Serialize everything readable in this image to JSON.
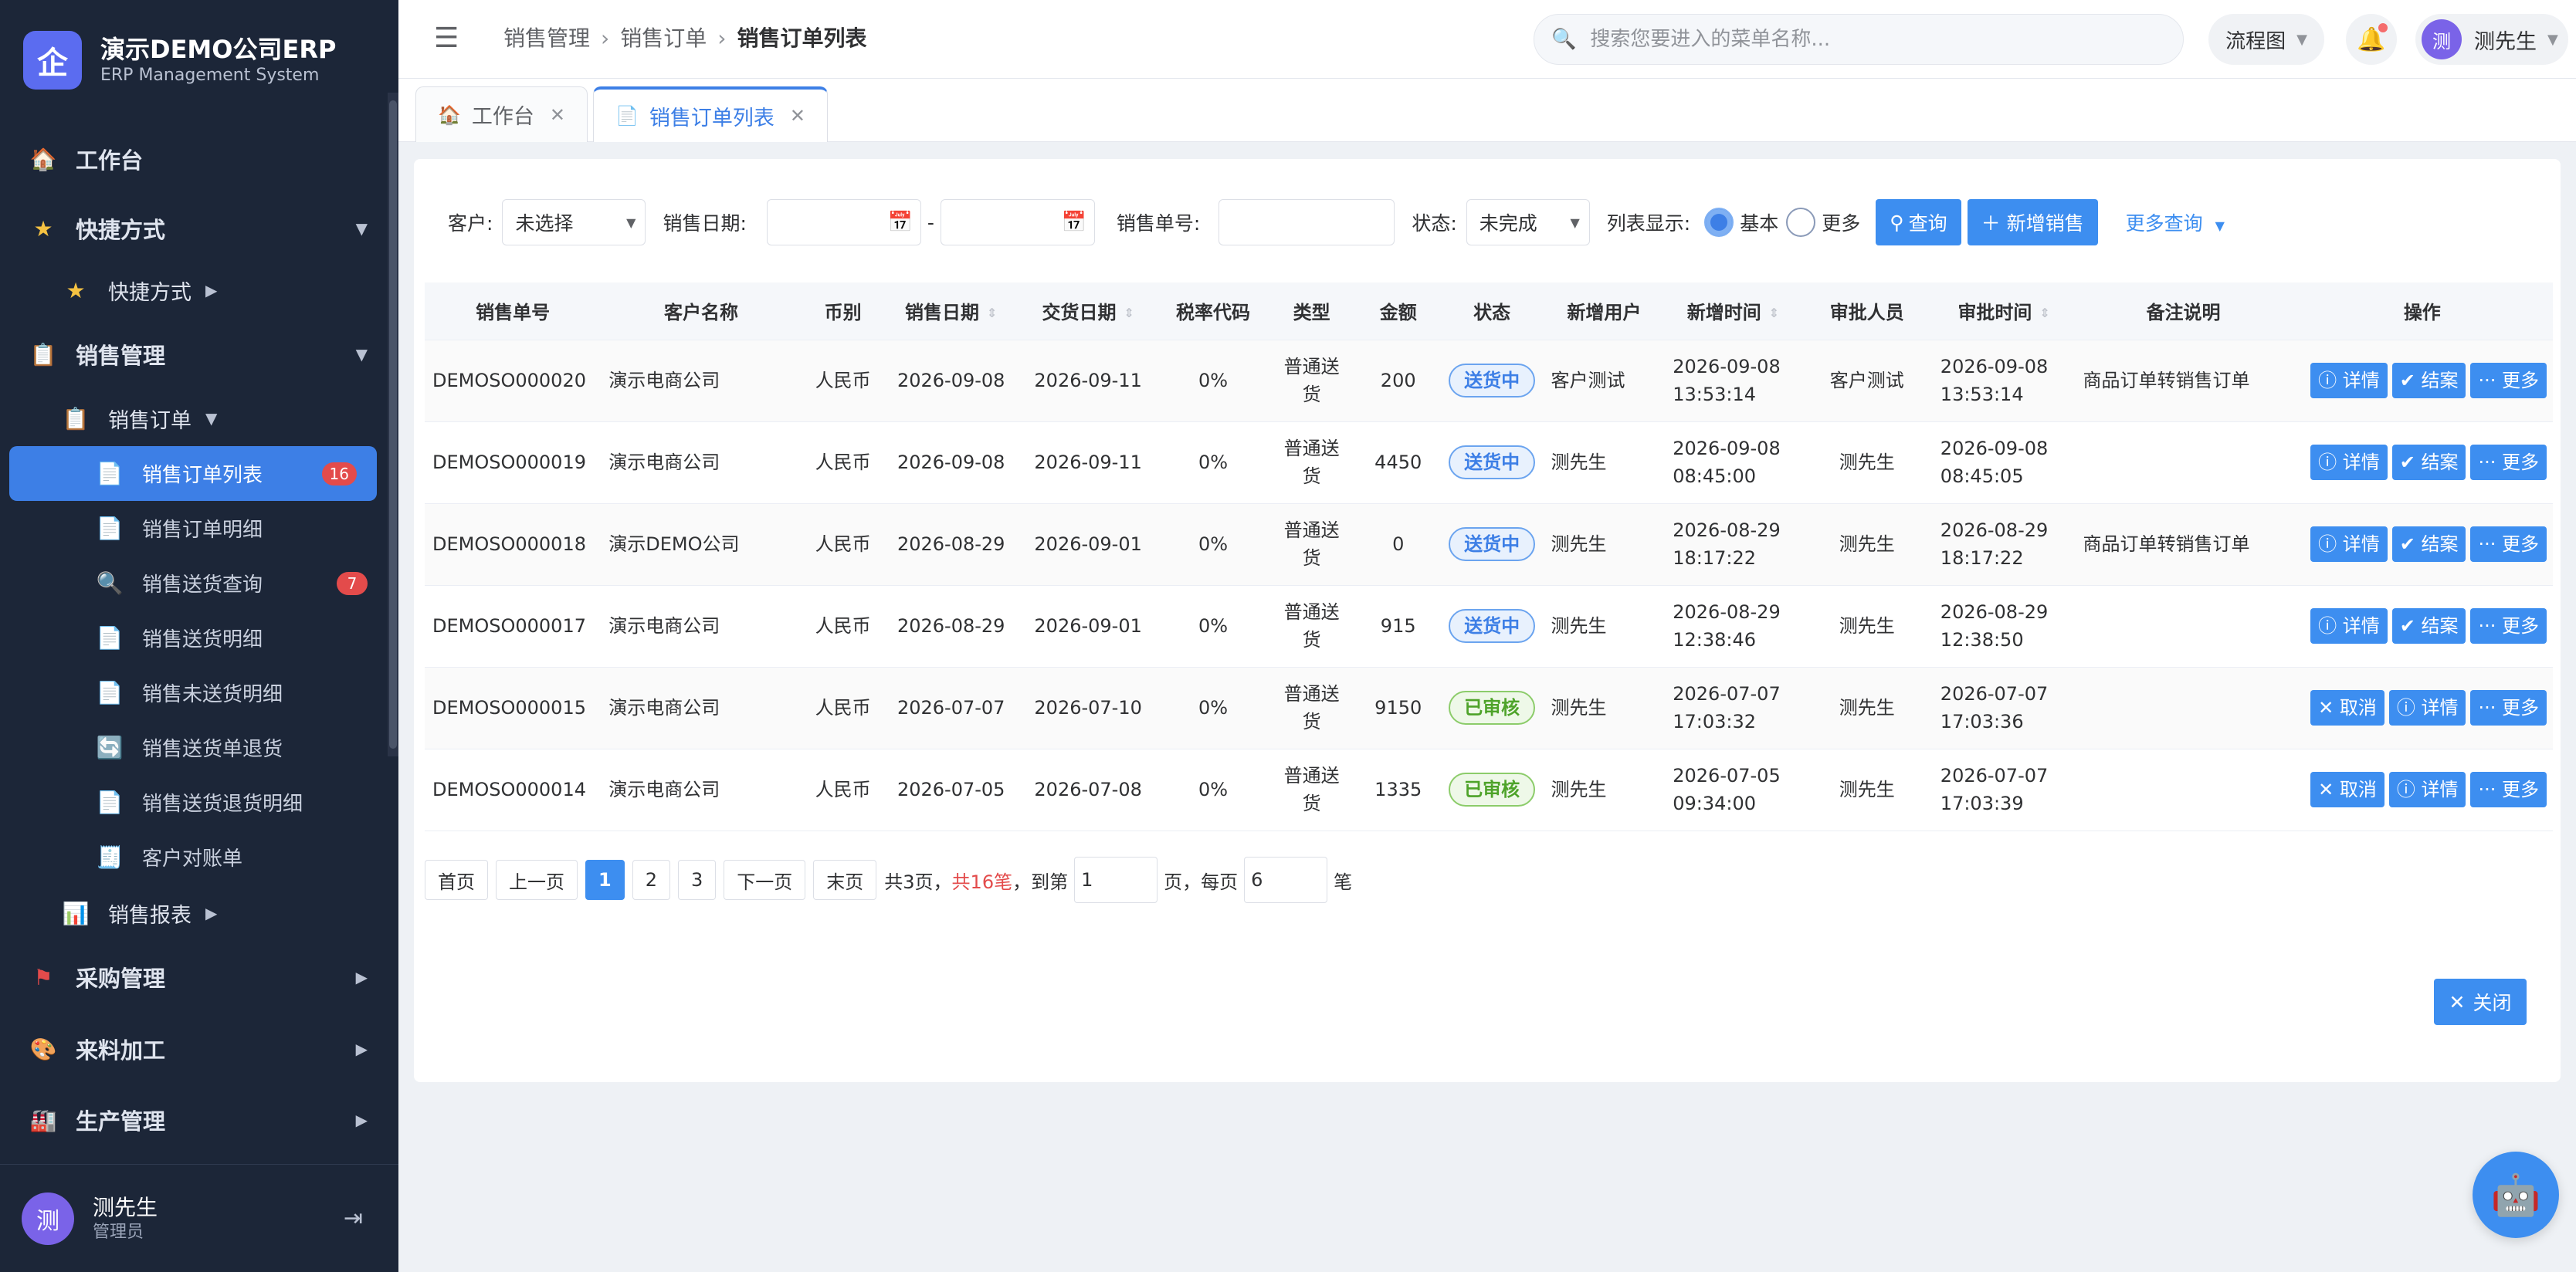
{
  "brand": {
    "logo_char": "企",
    "title": "演示DEMO公司ERP",
    "subtitle": "ERP Management System"
  },
  "sidebar": {
    "items": [
      {
        "label": "工作台",
        "icon": "home-icon"
      },
      {
        "label": "快捷方式",
        "icon": "star-icon"
      },
      {
        "label": "快捷方式",
        "icon": "star-icon"
      },
      {
        "label": "销售管理",
        "icon": "clipboard-icon"
      },
      {
        "label": "销售订单",
        "icon": "clipboard-icon"
      },
      {
        "label": "销售订单列表",
        "icon": "document-icon",
        "badge": "16"
      },
      {
        "label": "销售订单明细",
        "icon": "document-icon"
      },
      {
        "label": "销售送货查询",
        "icon": "search-icon",
        "badge": "7"
      },
      {
        "label": "销售送货明细",
        "icon": "document-icon"
      },
      {
        "label": "销售未送货明细",
        "icon": "document-icon"
      },
      {
        "label": "销售送货单退货",
        "icon": "refresh-icon"
      },
      {
        "label": "销售送货退货明细",
        "icon": "document-icon"
      },
      {
        "label": "客户对账单",
        "icon": "receipt-icon"
      },
      {
        "label": "销售报表",
        "icon": "chart-icon"
      },
      {
        "label": "采购管理",
        "icon": "flag-icon"
      },
      {
        "label": "来料加工",
        "icon": "palette-icon"
      },
      {
        "label": "生产管理",
        "icon": "factory-icon"
      }
    ],
    "user": {
      "avatar": "测",
      "name": "测先生",
      "role": "管理员"
    }
  },
  "header": {
    "breadcrumb": [
      "销售管理",
      "销售订单",
      "销售订单列表"
    ],
    "search_placeholder": "搜索您要进入的菜单名称...",
    "flow_label": "流程图",
    "user_avatar": "测",
    "user_name": "测先生"
  },
  "tabs": [
    {
      "label": "工作台"
    },
    {
      "label": "销售订单列表",
      "active": true
    }
  ],
  "filters": {
    "customer_label": "客户:",
    "customer_value": "未选择",
    "date_label": "销售日期:",
    "date_sep": "-",
    "order_no_label": "销售单号:",
    "status_label": "状态:",
    "status_value": "未完成",
    "display_label": "列表显示:",
    "radio_basic": "基本",
    "radio_more": "更多",
    "query_button": "查询",
    "add_button": "新增销售",
    "more_query": "更多查询"
  },
  "table": {
    "columns": [
      "销售单号",
      "客户名称",
      "币别",
      "销售日期",
      "交货日期",
      "税率代码",
      "类型",
      "金额",
      "状态",
      "新增用户",
      "新增时间",
      "审批人员",
      "审批时间",
      "备注说明",
      "操作"
    ],
    "rows": [
      {
        "no": "DEMOSO000020",
        "customer": "演示电商公司",
        "currency": "人民币",
        "sale_date": "2026-09-08",
        "delivery_date": "2026-09-11",
        "tax": "0%",
        "type_a": "普通送",
        "type_b": "货",
        "amount": "200",
        "status": "送货中",
        "status_kind": "ship",
        "add_user": "客户测试",
        "add_time_a": "2026-09-08",
        "add_time_b": "13:53:14",
        "approver": "客户测试",
        "approve_time_a": "2026-09-08",
        "approve_time_b": "13:53:14",
        "remark": "商品订单转销售订单",
        "ops": [
          "ⓘ 详情",
          "✔ 结案",
          "··· 更多"
        ]
      },
      {
        "no": "DEMOSO000019",
        "customer": "演示电商公司",
        "currency": "人民币",
        "sale_date": "2026-09-08",
        "delivery_date": "2026-09-11",
        "tax": "0%",
        "type_a": "普通送",
        "type_b": "货",
        "amount": "4450",
        "status": "送货中",
        "status_kind": "ship",
        "add_user": "测先生",
        "add_time_a": "2026-09-08",
        "add_time_b": "08:45:00",
        "approver": "测先生",
        "approve_time_a": "2026-09-08",
        "approve_time_b": "08:45:05",
        "remark": "",
        "ops": [
          "ⓘ 详情",
          "✔ 结案",
          "··· 更多"
        ]
      },
      {
        "no": "DEMOSO000018",
        "customer": "演示DEMO公司",
        "currency": "人民币",
        "sale_date": "2026-08-29",
        "delivery_date": "2026-09-01",
        "tax": "0%",
        "type_a": "普通送",
        "type_b": "货",
        "amount": "0",
        "status": "送货中",
        "status_kind": "ship",
        "add_user": "测先生",
        "add_time_a": "2026-08-29",
        "add_time_b": "18:17:22",
        "approver": "测先生",
        "approve_time_a": "2026-08-29",
        "approve_time_b": "18:17:22",
        "remark": "商品订单转销售订单",
        "ops": [
          "ⓘ 详情",
          "✔ 结案",
          "··· 更多"
        ]
      },
      {
        "no": "DEMOSO000017",
        "customer": "演示电商公司",
        "currency": "人民币",
        "sale_date": "2026-08-29",
        "delivery_date": "2026-09-01",
        "tax": "0%",
        "type_a": "普通送",
        "type_b": "货",
        "amount": "915",
        "status": "送货中",
        "status_kind": "ship",
        "add_user": "测先生",
        "add_time_a": "2026-08-29",
        "add_time_b": "12:38:46",
        "approver": "测先生",
        "approve_time_a": "2026-08-29",
        "approve_time_b": "12:38:50",
        "remark": "",
        "ops": [
          "ⓘ 详情",
          "✔ 结案",
          "··· 更多"
        ]
      },
      {
        "no": "DEMOSO000015",
        "customer": "演示电商公司",
        "currency": "人民币",
        "sale_date": "2026-07-07",
        "delivery_date": "2026-07-10",
        "tax": "0%",
        "type_a": "普通送",
        "type_b": "货",
        "amount": "9150",
        "status": "已审核",
        "status_kind": "ok",
        "add_user": "测先生",
        "add_time_a": "2026-07-07",
        "add_time_b": "17:03:32",
        "approver": "测先生",
        "approve_time_a": "2026-07-07",
        "approve_time_b": "17:03:36",
        "remark": "",
        "ops": [
          "✕ 取消",
          "ⓘ 详情",
          "··· 更多"
        ]
      },
      {
        "no": "DEMOSO000014",
        "customer": "演示电商公司",
        "currency": "人民币",
        "sale_date": "2026-07-05",
        "delivery_date": "2026-07-08",
        "tax": "0%",
        "type_a": "普通送",
        "type_b": "货",
        "amount": "1335",
        "status": "已审核",
        "status_kind": "ok",
        "add_user": "测先生",
        "add_time_a": "2026-07-05",
        "add_time_b": "09:34:00",
        "approver": "测先生",
        "approve_time_a": "2026-07-07",
        "approve_time_b": "17:03:39",
        "remark": "",
        "ops": [
          "✕ 取消",
          "ⓘ 详情",
          "··· 更多"
        ]
      }
    ]
  },
  "pager": {
    "first": "首页",
    "prev": "上一页",
    "pages": [
      "1",
      "2",
      "3"
    ],
    "current": "1",
    "next": "下一页",
    "last": "末页",
    "total_pages_text": "共3页，",
    "total_count_text": "共16笔",
    "goto_prefix": "，到第",
    "goto_value": "1",
    "goto_suffix": "页，每页",
    "page_size": "6",
    "unit": "笔"
  },
  "close_button": "关闭",
  "colors": {
    "primary": "#3d8ef0",
    "sidebar_bg": "#1c2638",
    "active_menu": "#3d7fe6",
    "badge_red": "#e34b4b",
    "status_ship": "#3d7fe6",
    "status_ok": "#4ea32a"
  }
}
